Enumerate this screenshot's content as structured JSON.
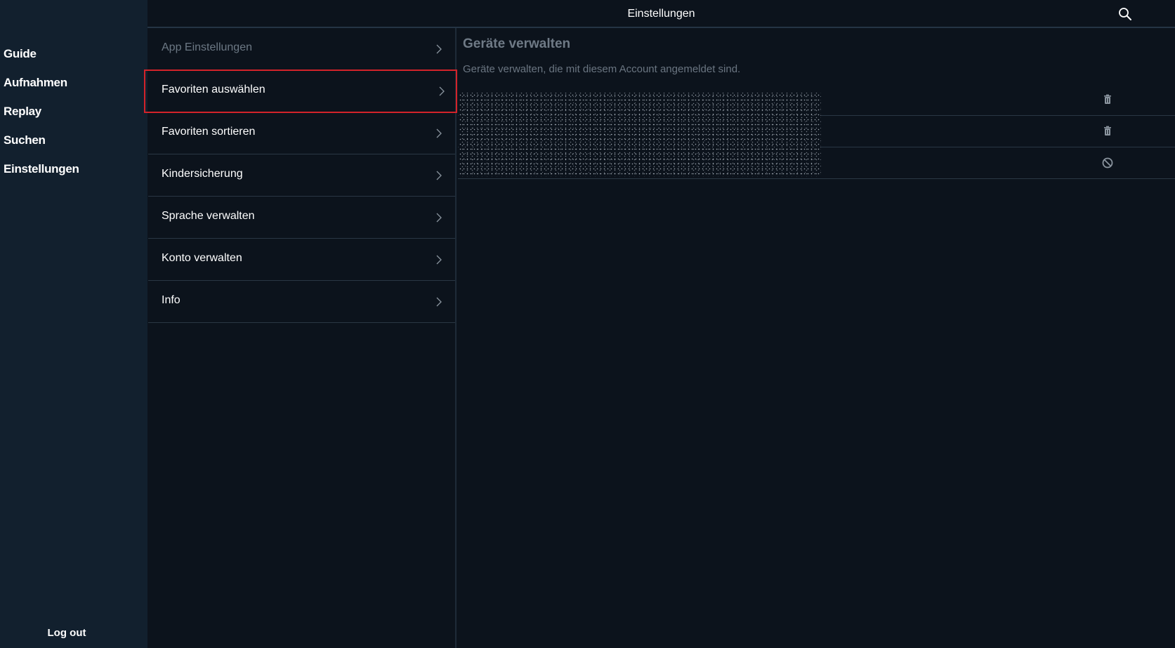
{
  "header": {
    "title": "Einstellungen",
    "search_icon": "search-icon"
  },
  "sidebar": {
    "items": [
      {
        "label": "Guide"
      },
      {
        "label": "Aufnahmen"
      },
      {
        "label": "Replay"
      },
      {
        "label": "Suchen"
      },
      {
        "label": "Einstellungen"
      }
    ],
    "logout_label": "Log out"
  },
  "menu": {
    "items": [
      {
        "label": "App Einstellungen",
        "state": "dimmed"
      },
      {
        "label": "Favoriten auswählen",
        "state": "highlighted"
      },
      {
        "label": "Favoriten sortieren"
      },
      {
        "label": "Kindersicherung"
      },
      {
        "label": "Sprache verwalten"
      },
      {
        "label": "Konto verwalten"
      },
      {
        "label": "Info"
      }
    ],
    "chevron_icon": "chevron-right-icon"
  },
  "content": {
    "title": "Geräte verwalten",
    "description": "Geräte verwalten, die mit diesem Account angemeldet sind.",
    "devices": [
      {
        "action_icon": "trash-icon"
      },
      {
        "action_icon": "trash-icon"
      },
      {
        "action_icon": "block-icon"
      }
    ]
  },
  "colors": {
    "background": "#0c131c",
    "sidebar": "#12202e",
    "highlight_border": "#d3232a",
    "muted_text": "#6f7a86"
  }
}
